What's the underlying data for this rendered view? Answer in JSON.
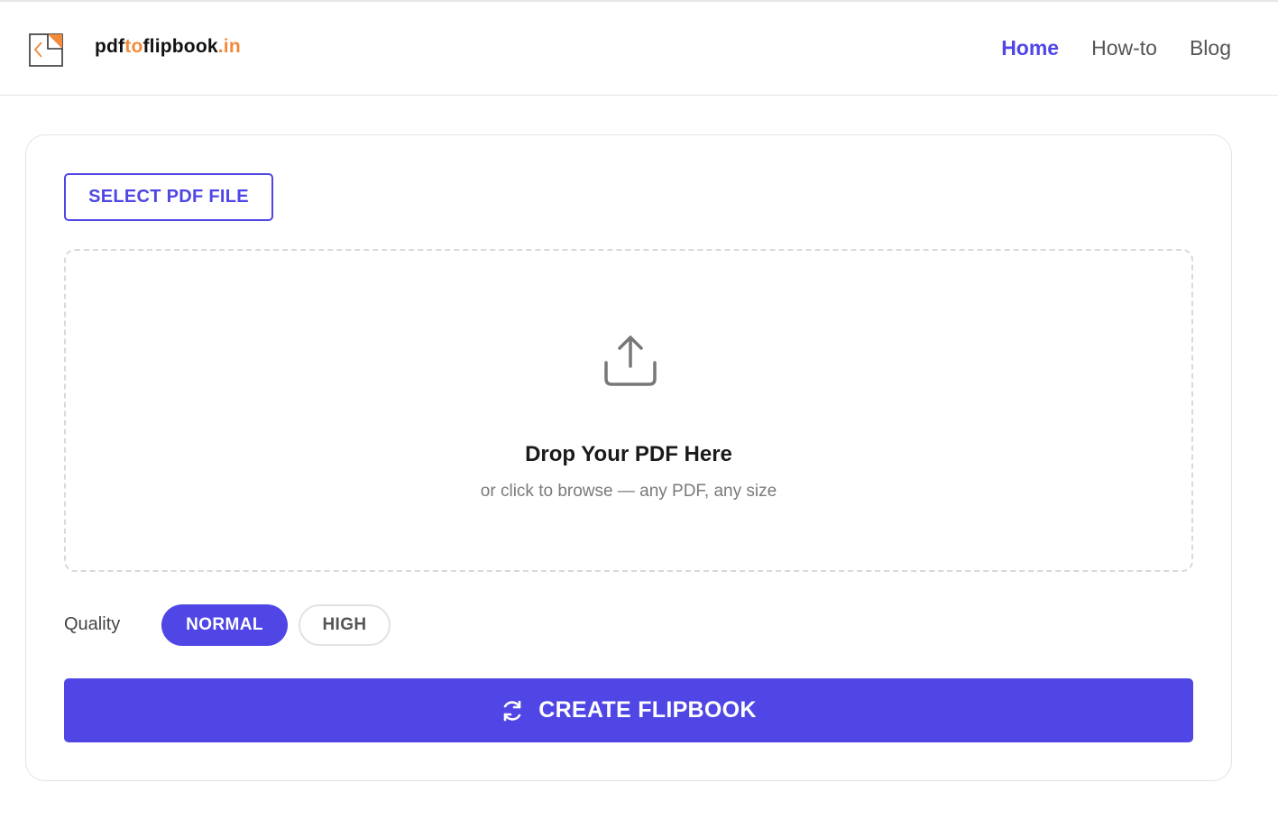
{
  "brand": {
    "name_prefix": "pdf",
    "name_accent": "to",
    "name_mid": "flipbook",
    "name_suffix": ".in",
    "logo_icon": "flipbook-logo-icon",
    "accent_color": "#f28a3b"
  },
  "nav": {
    "items": [
      {
        "label": "Home",
        "active": true
      },
      {
        "label": "How-to",
        "active": false
      },
      {
        "label": "Blog",
        "active": false
      }
    ]
  },
  "main": {
    "select_button_label": "SELECT PDF FILE",
    "dropzone": {
      "icon": "upload-icon",
      "title": "Drop Your PDF Here",
      "subtitle": "or click to browse — any PDF, any size"
    },
    "quality": {
      "label": "Quality",
      "options": [
        "NORMAL",
        "HIGH"
      ],
      "selected": "NORMAL"
    },
    "create_button_label": "CREATE FLIPBOOK",
    "create_button_icon": "refresh-icon"
  },
  "colors": {
    "primary": "#4f46e5",
    "accent": "#f28a3b"
  }
}
